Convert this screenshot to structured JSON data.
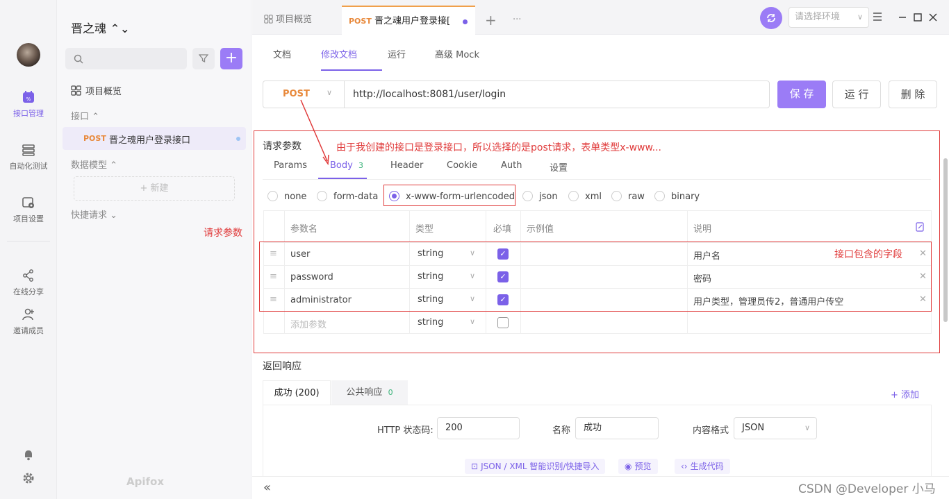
{
  "rail": {
    "items": [
      {
        "label": "接口管理",
        "icon": "api-management-icon"
      },
      {
        "label": "自动化测试",
        "icon": "automated-test-icon"
      },
      {
        "label": "项目设置",
        "icon": "project-settings-icon"
      },
      {
        "label": "在线分享",
        "icon": "share-icon"
      },
      {
        "label": "邀请成员",
        "icon": "invite-member-icon"
      }
    ]
  },
  "sidebar": {
    "project_name": "晋之魂 ⌃⌄",
    "overview": "项目概览",
    "section_api": "接口 ⌃",
    "api_item_method": "POST",
    "api_item_name": "晋之魂用户登录接口",
    "section_models": "数据模型 ⌃",
    "new_label": "+ 新建",
    "section_quick": "快捷请求 ⌄",
    "logo": "Apifox"
  },
  "tabs": {
    "overview": "项目概览",
    "active_method": "POST",
    "active_name": "晋之魂用户登录接[",
    "plus": "+",
    "more": "···"
  },
  "env": {
    "placeholder": "请选择环境"
  },
  "subtabs": [
    "文档",
    "修改文档",
    "运行",
    "高级 Mock"
  ],
  "request": {
    "method": "POST",
    "url": "http://localhost:8081/user/login",
    "save": "保 存",
    "run": "运 行",
    "delete": "删 除"
  },
  "params": {
    "title": "请求参数",
    "tabs": [
      "Params",
      "Body",
      "Header",
      "Cookie",
      "Auth",
      "设置"
    ],
    "body_count": "3",
    "body_types": [
      "none",
      "form-data",
      "x-www-form-urlencoded",
      "json",
      "xml",
      "raw",
      "binary"
    ],
    "selected_body_type": "x-www-form-urlencoded",
    "columns": [
      "参数名",
      "类型",
      "必填",
      "示例值",
      "说明"
    ],
    "rows": [
      {
        "name": "user",
        "type": "string",
        "required": true,
        "example": "",
        "desc": "用户名"
      },
      {
        "name": "password",
        "type": "string",
        "required": true,
        "example": "",
        "desc": "密码"
      },
      {
        "name": "administrator",
        "type": "string",
        "required": true,
        "example": "",
        "desc": "用户类型，管理员传2，普通用户传空"
      }
    ],
    "add_placeholder": "添加参数",
    "add_type": "string"
  },
  "annotations": {
    "top": "由于我创建的接口是登录接口，所以选择的是post请求，表单类型x-www...",
    "left": "请求参数",
    "fields": "接口包含的字段"
  },
  "response": {
    "title": "返回响应",
    "tab_success": "成功 (200)",
    "tab_common": "公共响应",
    "common_count": "0",
    "add": "+ 添加",
    "status_label": "HTTP 状态码:",
    "status_value": "200",
    "name_label": "名称",
    "name_value": "成功",
    "format_label": "内容格式",
    "format_value": "JSON",
    "link_import": "JSON / XML 智能识别/快捷导入",
    "link_preview": "预览",
    "link_code": "生成代码"
  },
  "bottom": {
    "collapse": "«",
    "watermark": "CSDN @Developer 小马"
  },
  "colors": {
    "accent": "#9b7cf6",
    "post": "#e8893b",
    "annotation": "#e03a3a"
  }
}
